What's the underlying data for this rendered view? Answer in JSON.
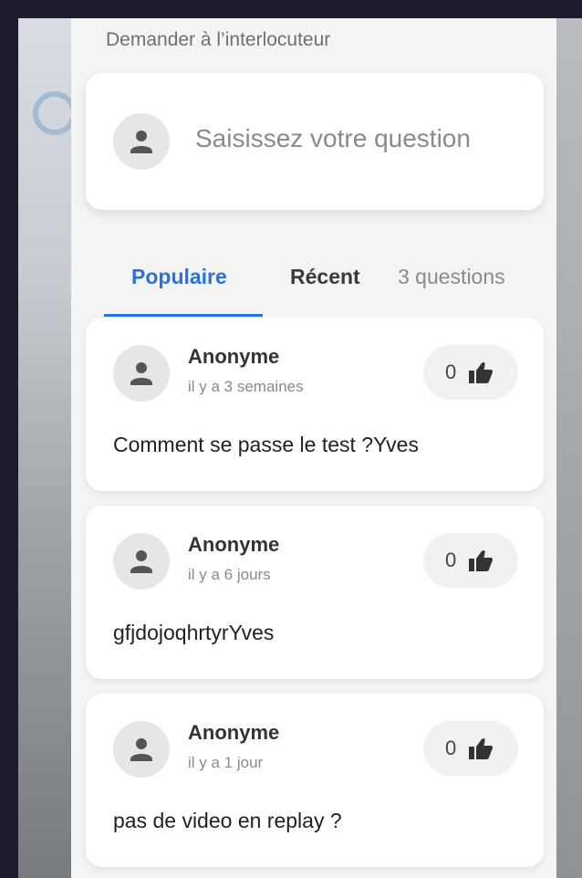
{
  "ask": {
    "label": "Demander à l’interlocuteur",
    "placeholder": "Saisissez votre question"
  },
  "tabs": {
    "popular_label": "Populaire",
    "recent_label": "Récent",
    "count_label": "3 questions",
    "active": "popular"
  },
  "questions": [
    {
      "author": "Anonyme",
      "time": "il y a 3 semaines",
      "likes": "0",
      "text": "Comment se passe le test ?Yves"
    },
    {
      "author": "Anonyme",
      "time": "il y a 6 jours",
      "likes": "0",
      "text": "gfjdojoqhrtyrYves"
    },
    {
      "author": "Anonyme",
      "time": "il y a 1 jour",
      "likes": "0",
      "text": "pas de video en replay ?"
    }
  ],
  "colors": {
    "accent": "#2a72e0",
    "panel_bg": "#f4f4f4",
    "card_bg": "#ffffff",
    "outer_bg": "#1f1a2e"
  },
  "icons": {
    "avatar": "person-icon",
    "like": "thumbs-up-icon"
  }
}
